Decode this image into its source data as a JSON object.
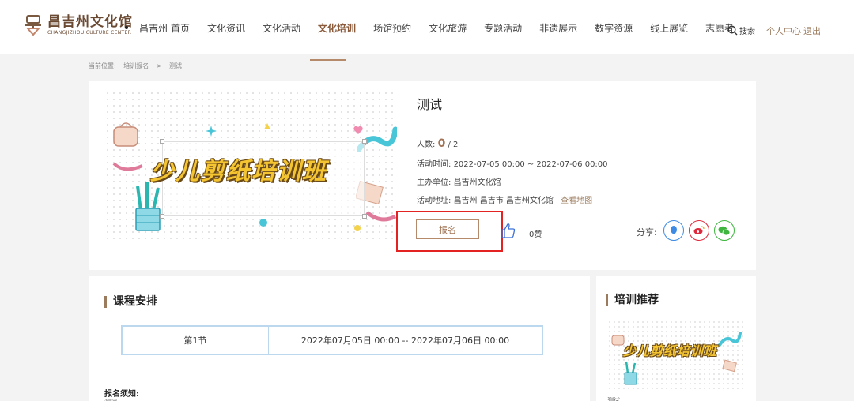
{
  "header": {
    "logo_cn": "昌吉州文化馆",
    "logo_en": "CHANGJIZHOU CULTURE CENTER",
    "city": "昌吉州",
    "nav": [
      {
        "label": "首页"
      },
      {
        "label": "文化资讯"
      },
      {
        "label": "文化活动"
      },
      {
        "label": "文化培训",
        "active": true
      },
      {
        "label": "场馆预约"
      },
      {
        "label": "文化旅游"
      },
      {
        "label": "专题活动"
      },
      {
        "label": "非遗展示"
      },
      {
        "label": "数字资源"
      },
      {
        "label": "线上展览"
      },
      {
        "label": "志愿者"
      }
    ],
    "search_label": "搜索",
    "user_center": "个人中心",
    "logout": "退出"
  },
  "breadcrumb": {
    "prefix": "当前位置:",
    "level1": "培训报名",
    "sep": ">",
    "level2": "测试"
  },
  "detail": {
    "banner_text": "少儿剪纸培训班",
    "title": "测试",
    "count_label": "人数:",
    "count_current": "0",
    "count_total": "/ 2",
    "time_label": "活动时间:",
    "time_value": "2022-07-05 00:00 ~ 2022-07-06 00:00",
    "organizer_label": "主办单位:",
    "organizer_value": "昌吉州文化馆",
    "address_label": "活动地址:",
    "address_value": "昌吉州 昌吉市 昌吉州文化馆",
    "map_link": "查看地图",
    "signup_button": "报名",
    "like_count": "0赞",
    "share_label": "分享:",
    "share_icons": [
      "qq-icon",
      "weibo-icon",
      "wechat-icon"
    ]
  },
  "course": {
    "title": "课程安排",
    "rows": [
      {
        "section": "第1节",
        "time": "2022年07月05日 00:00 -- 2022年07月06日 00:00"
      }
    ],
    "notice_title": "报名须知:",
    "notice_text": "测试"
  },
  "recommend": {
    "title": "培训推荐",
    "item_banner": "少儿剪纸培训班",
    "item_caption": "测试"
  },
  "colors": {
    "accent": "#9b7b5e",
    "highlight": "#e32222",
    "qq": "#3d8be5",
    "weibo": "#e0283c",
    "wechat": "#3fb53f"
  }
}
